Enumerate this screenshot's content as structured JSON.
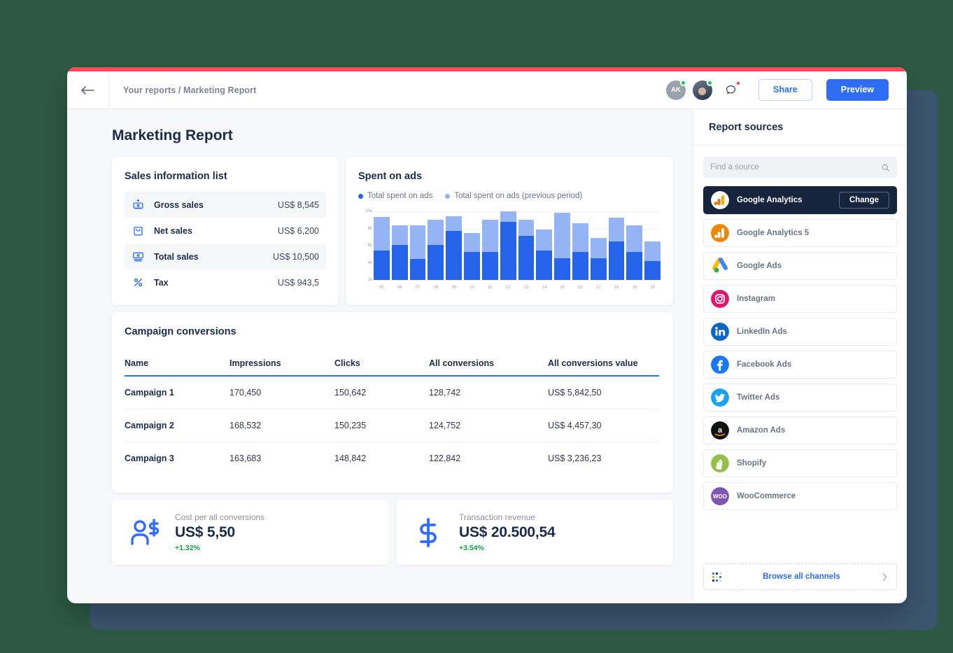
{
  "header": {
    "breadcrumb": "Your reports / Marketing Report",
    "back_icon": "arrow-left-icon",
    "avatar_initials": "AK",
    "chat_icon": "chat-bubble-icon",
    "share_label": "Share",
    "preview_label": "Preview",
    "accent_color": "#ff4757",
    "primary_color": "#2f6df6"
  },
  "page": {
    "title": "Marketing Report"
  },
  "sales": {
    "title": "Sales information list",
    "rows": [
      {
        "icon": "cash-register-icon",
        "label": "Gross sales",
        "value": "US$ 8,545"
      },
      {
        "icon": "shopping-bag-icon",
        "label": "Net sales",
        "value": "US$ 6,200"
      },
      {
        "icon": "banknote-icon",
        "label": "Total sales",
        "value": "US$ 10,500"
      },
      {
        "icon": "percent-icon",
        "label": "Tax",
        "value": "US$ 943,5"
      }
    ]
  },
  "chart_data": {
    "type": "bar",
    "title": "Spent on ads",
    "stacked": true,
    "xlabel": "",
    "ylabel": "",
    "ylim": [
      2000,
      10000
    ],
    "yticks": [
      "2k",
      "4k",
      "6k",
      "8k",
      "10k"
    ],
    "grid": true,
    "legend_position": "top-left",
    "categories": [
      "05",
      "06",
      "07",
      "08",
      "09",
      "10",
      "11",
      "12",
      "13",
      "14",
      "15",
      "16",
      "17",
      "18",
      "19",
      "20"
    ],
    "series": [
      {
        "name": "Total spent on ads",
        "color": "#2563eb",
        "values": [
          5400,
          6050,
          4450,
          6050,
          7700,
          5250,
          5250,
          8750,
          7150,
          5450,
          4550,
          5250,
          4550,
          6500,
          5250,
          4200
        ]
      },
      {
        "name": "Total spent on ads (previous period)",
        "color": "#94b4f5",
        "values": [
          9350,
          8350,
          8350,
          9050,
          9450,
          7500,
          9050,
          10350,
          9050,
          7900,
          9800,
          8650,
          6900,
          9250,
          8350,
          6500
        ]
      }
    ],
    "legend": [
      "Total spent on ads",
      "Total spent on ads (previous period)"
    ]
  },
  "campaigns": {
    "title": "Campaign conversions",
    "columns": [
      "Name",
      "Impressions",
      "Clicks",
      "All conversions",
      "All conversions value"
    ],
    "rows": [
      [
        "Campaign 1",
        "170,450",
        "150,642",
        "128,742",
        "US$ 5,842,50"
      ],
      [
        "Campaign 2",
        "168,532",
        "150,235",
        "124,752",
        "US$ 4,457,30"
      ],
      [
        "Campaign 3",
        "163,683",
        "148,842",
        "122,842",
        "US$ 3,236,23"
      ]
    ]
  },
  "metrics": [
    {
      "icon": "user-dollar-icon",
      "label": "Cost per all conversions",
      "value": "US$ 5,50",
      "delta": "+1.32%"
    },
    {
      "icon": "dollar-sign-icon",
      "label": "Transaction revenue",
      "value": "US$ 20.500,54",
      "delta": "+3.54%"
    }
  ],
  "sidebar": {
    "title": "Report sources",
    "search_placeholder": "Find a source",
    "search_value": "",
    "search_icon": "search-icon",
    "change_label": "Change",
    "sources": [
      {
        "name": "Google Analytics",
        "logo": "google-analytics-icon",
        "selected": true
      },
      {
        "name": "Google Analytics 5",
        "logo": "google-analytics-5-icon",
        "selected": false
      },
      {
        "name": "Google Ads",
        "logo": "google-ads-icon",
        "selected": false
      },
      {
        "name": "Instagram",
        "logo": "instagram-icon",
        "selected": false
      },
      {
        "name": "LinkedIn Ads",
        "logo": "linkedin-ads-icon",
        "selected": false
      },
      {
        "name": "Facebook Ads",
        "logo": "facebook-ads-icon",
        "selected": false
      },
      {
        "name": "Twitter Ads",
        "logo": "twitter-ads-icon",
        "selected": false
      },
      {
        "name": "Amazon Ads",
        "logo": "amazon-ads-icon",
        "selected": false
      },
      {
        "name": "Shopify",
        "logo": "shopify-icon",
        "selected": false
      },
      {
        "name": "WooCommerce",
        "logo": "woocommerce-icon",
        "selected": false
      }
    ],
    "browse_label": "Browse all channels",
    "browse_icon": "apps-grid-icon",
    "browse_chevron": "chevron-right-icon"
  }
}
